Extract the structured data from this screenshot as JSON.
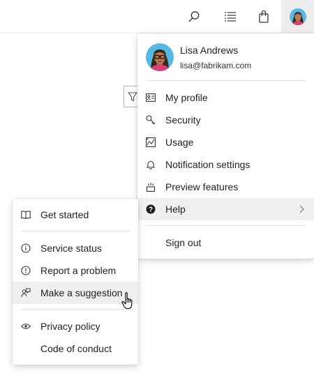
{
  "topbar": {
    "icons": [
      "search-icon",
      "work-items-icon",
      "marketplace-bag-icon",
      "user-avatar"
    ]
  },
  "user_menu": {
    "name": "Lisa Andrews",
    "email": "lisa@fabrikam.com",
    "items": [
      {
        "label": "My profile",
        "icon": "profile-card-icon"
      },
      {
        "label": "Security",
        "icon": "key-icon"
      },
      {
        "label": "Usage",
        "icon": "usage-chart-icon"
      },
      {
        "label": "Notification settings",
        "icon": "bell-icon"
      },
      {
        "label": "Preview features",
        "icon": "preview-features-icon"
      },
      {
        "label": "Help",
        "icon": "help-icon",
        "selected": true
      }
    ],
    "sign_out": "Sign out"
  },
  "help_menu": {
    "items": [
      {
        "label": "Get started",
        "icon": "book-icon"
      },
      {
        "label": "Service status",
        "icon": "info-icon"
      },
      {
        "label": "Report a problem",
        "icon": "alert-icon"
      },
      {
        "label": "Make a suggestion",
        "icon": "suggestion-icon",
        "hovered": true
      },
      {
        "label": "Privacy policy",
        "icon": "eye-icon"
      },
      {
        "label": "Code of conduct",
        "icon": ""
      }
    ]
  },
  "colors": {
    "avatar_bg": "#56b8e3",
    "hover_bg": "#efefef",
    "avatar_button_bg": "#ededed"
  }
}
